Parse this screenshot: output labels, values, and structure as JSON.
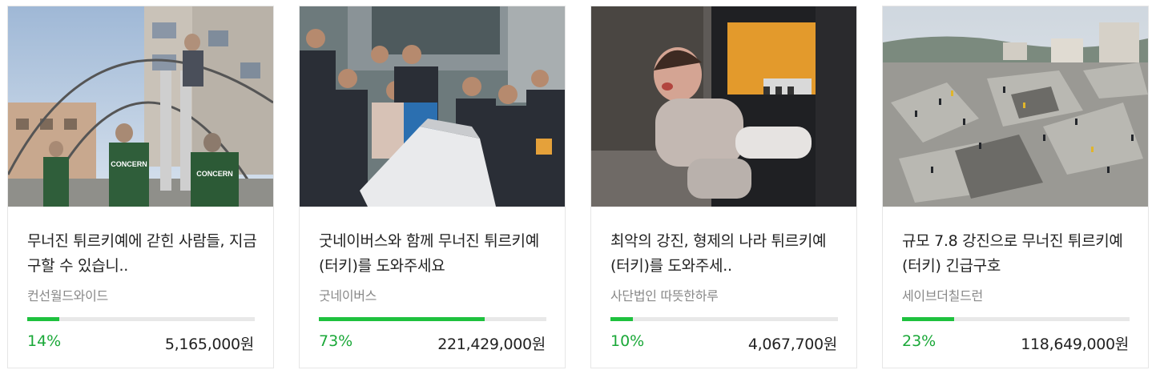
{
  "accent_color": "#1ec13e",
  "cards": [
    {
      "title": "무너진 튀르키예에 갇힌 사람들, 지금 구할 수 있습니..",
      "organization": "컨선월드와이드",
      "progress_percent": 14,
      "progress_label": "14%",
      "amount": "5,165,000원",
      "image_text": "CONCERN"
    },
    {
      "title": "굿네이버스와 함께 무너진 튀르키예(터키)를 도와주세요",
      "organization": "굿네이버스",
      "progress_percent": 73,
      "progress_label": "73%",
      "amount": "221,429,000원"
    },
    {
      "title": "최악의 강진, 형제의 나라 튀르키예(터키)를 도와주세..",
      "organization": "사단법인 따뜻한하루",
      "progress_percent": 10,
      "progress_label": "10%",
      "amount": "4,067,700원"
    },
    {
      "title": "규모 7.8 강진으로 무너진 튀르키예(터키) 긴급구호",
      "organization": "세이브더칠드런",
      "progress_percent": 23,
      "progress_label": "23%",
      "amount": "118,649,000원"
    }
  ]
}
